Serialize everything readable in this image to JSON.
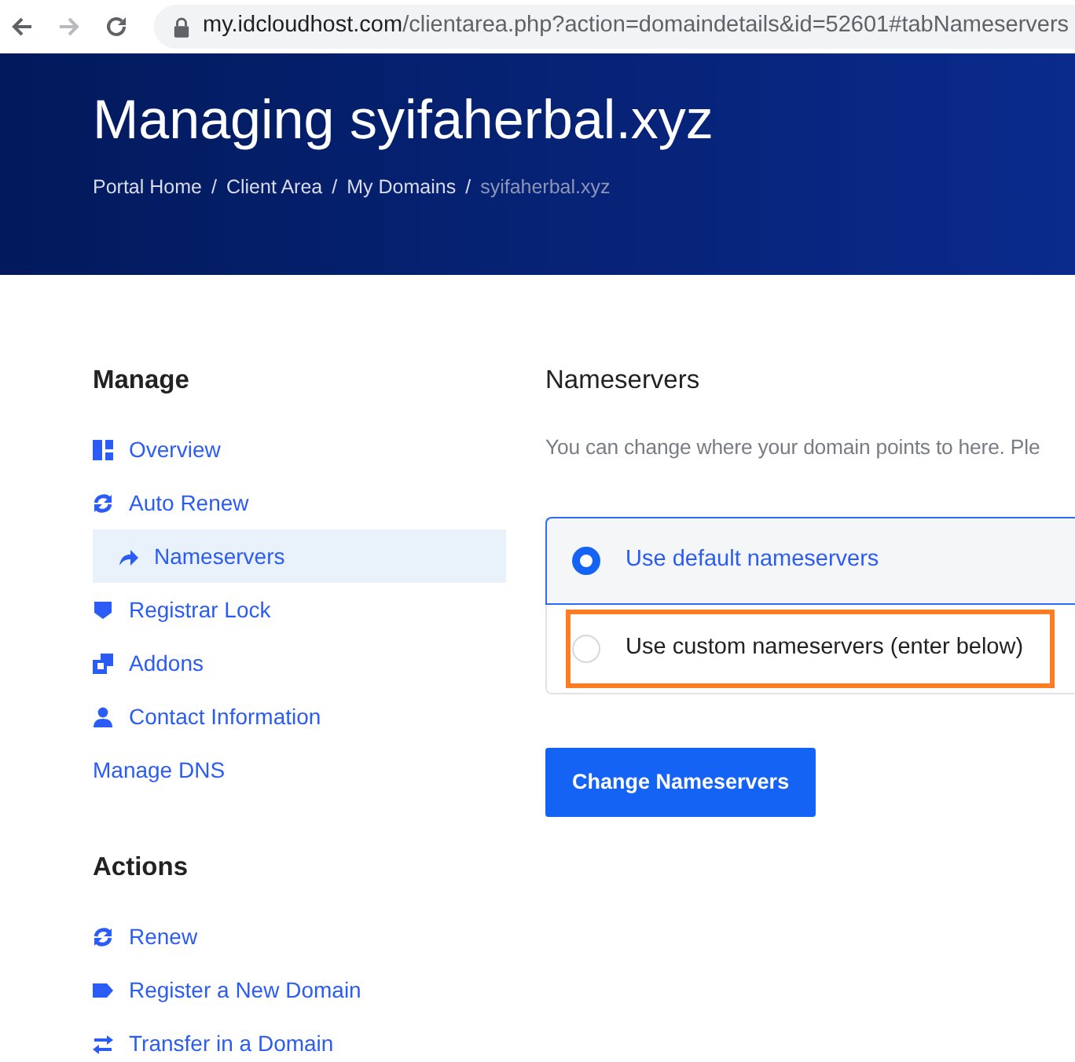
{
  "browser": {
    "url_host": "my.idcloudhost.com",
    "url_path": "/clientarea.php?action=domaindetails&id=52601#tabNameservers"
  },
  "header": {
    "title": "Managing syifaherbal.xyz",
    "breadcrumb": [
      {
        "label": "Portal Home",
        "current": false,
        "separator": "/"
      },
      {
        "label": "Client Area",
        "current": false,
        "separator": "/"
      },
      {
        "label": "My Domains",
        "current": false,
        "separator": "/"
      },
      {
        "label": "syifaherbal.xyz",
        "current": true
      }
    ]
  },
  "sidebar": {
    "manage": {
      "title": "Manage",
      "items": [
        {
          "label": "Overview",
          "selected": false
        },
        {
          "label": "Auto Renew",
          "selected": false
        },
        {
          "label": "Nameservers",
          "selected": true
        },
        {
          "label": "Registrar Lock",
          "selected": false
        },
        {
          "label": "Addons",
          "selected": false
        },
        {
          "label": "Contact Information",
          "selected": false
        },
        {
          "label": "Manage DNS",
          "selected": false
        }
      ]
    },
    "actions": {
      "title": "Actions",
      "items": [
        {
          "label": "Renew"
        },
        {
          "label": "Register a New Domain"
        },
        {
          "label": "Transfer in a Domain"
        }
      ]
    }
  },
  "content": {
    "title": "Nameservers",
    "description": "You can change where your domain points to here. Ple",
    "options": [
      {
        "label": "Use default nameservers",
        "selected": true,
        "highlighted": false
      },
      {
        "label": "Use custom nameservers (enter below)",
        "selected": false,
        "highlighted": true
      }
    ],
    "button": "Change Nameservers"
  }
}
